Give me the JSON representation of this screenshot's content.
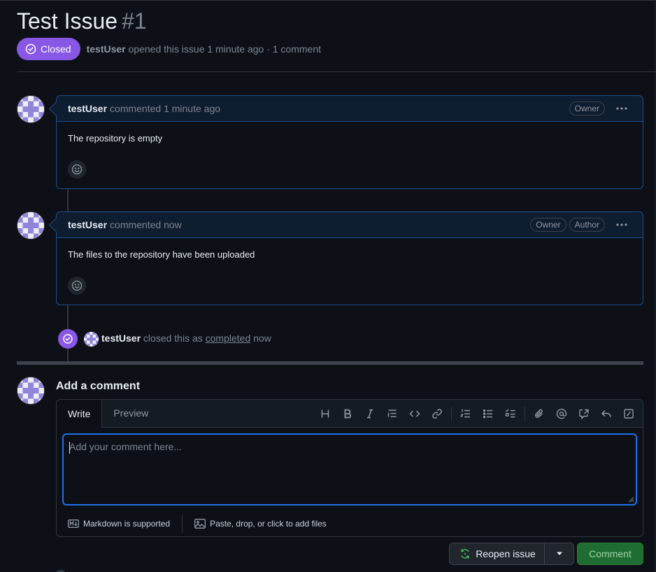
{
  "issue": {
    "title": "Test Issue",
    "number": "#1",
    "state_label": "Closed",
    "author": "testUser",
    "opened_text": "opened this issue 1 minute ago · 1 comment"
  },
  "comments": [
    {
      "author": "testUser",
      "time": "commented 1 minute ago",
      "labels": [
        "Owner"
      ],
      "body": "The repository is empty"
    },
    {
      "author": "testUser",
      "time": "commented now",
      "labels": [
        "Owner",
        "Author"
      ],
      "body": "The files to the repository have been uploaded"
    }
  ],
  "event": {
    "actor": "testUser",
    "text_before": "closed this as",
    "link": "completed",
    "text_after": "now"
  },
  "new_comment": {
    "heading": "Add a comment",
    "tab_write": "Write",
    "tab_preview": "Preview",
    "placeholder": "Add your comment here...",
    "markdown_note": "Markdown is supported",
    "files_note": "Paste, drop, or click to add files"
  },
  "buttons": {
    "reopen": "Reopen issue",
    "comment": "Comment"
  },
  "colors": {
    "closed_purple": "#8957e5",
    "focus_blue": "#1f6feb",
    "comment_green": "#1f6d33",
    "reopen_icon_green": "#3fb950"
  }
}
